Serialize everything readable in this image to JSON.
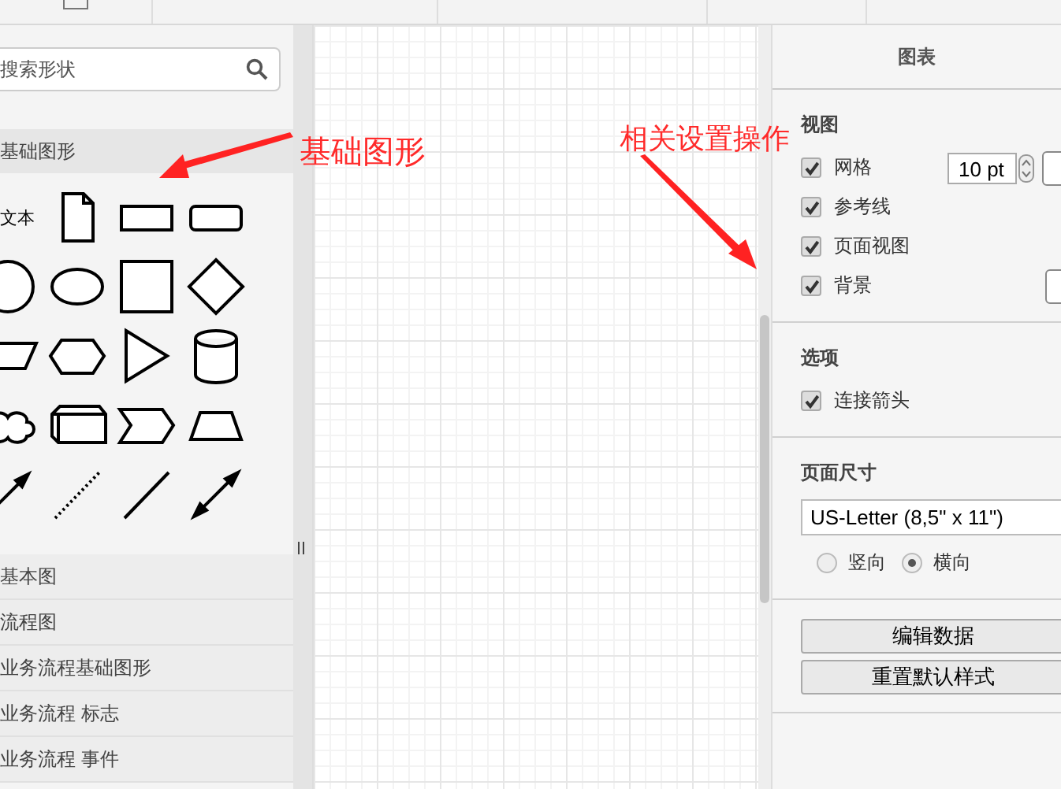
{
  "sidebar": {
    "search": {
      "placeholder": "搜索形状"
    },
    "sections": [
      {
        "title": "基础图形",
        "expanded": true,
        "shapes": [
          {
            "kind": "text",
            "label": "文本"
          },
          {
            "kind": "document"
          },
          {
            "kind": "rectangle"
          },
          {
            "kind": "rounded-rectangle"
          },
          {
            "kind": "circle"
          },
          {
            "kind": "ellipse"
          },
          {
            "kind": "square"
          },
          {
            "kind": "diamond"
          },
          {
            "kind": "parallelogram"
          },
          {
            "kind": "hexagon"
          },
          {
            "kind": "triangle"
          },
          {
            "kind": "cylinder"
          },
          {
            "kind": "cloud"
          },
          {
            "kind": "cube"
          },
          {
            "kind": "step"
          },
          {
            "kind": "trapezoid"
          },
          {
            "kind": "arrow"
          },
          {
            "kind": "dotted-line"
          },
          {
            "kind": "line"
          },
          {
            "kind": "double-arrow"
          }
        ]
      },
      {
        "title": "基本图",
        "expanded": false
      },
      {
        "title": "流程图",
        "expanded": false
      },
      {
        "title": "业务流程基础图形",
        "expanded": false
      },
      {
        "title": "业务流程 标志",
        "expanded": false
      },
      {
        "title": "业务流程 事件",
        "expanded": false
      }
    ]
  },
  "format_panel": {
    "title": "图表",
    "sections": [
      {
        "title": "视图",
        "options": [
          {
            "kind": "spin-color",
            "label": "网格",
            "checked": true,
            "value": "10 pt"
          },
          {
            "kind": "plain",
            "label": "参考线",
            "checked": true
          },
          {
            "kind": "plain",
            "label": "页面视图",
            "checked": true
          },
          {
            "kind": "color",
            "label": "背景",
            "checked": true
          }
        ]
      },
      {
        "title": "选项",
        "options": [
          {
            "kind": "plain",
            "label": "连接箭头",
            "checked": true
          }
        ]
      }
    ],
    "page_size": {
      "title": "页面尺寸",
      "value": "US-Letter (8,5\" x 11\")",
      "orientations": [
        {
          "label": "竖向",
          "selected": false
        },
        {
          "label": "横向",
          "selected": true
        }
      ]
    },
    "buttons": [
      "编辑数据",
      "重置默认样式"
    ]
  },
  "annotations": [
    {
      "text": "基础图形"
    },
    {
      "text": "相关设置操作"
    }
  ]
}
